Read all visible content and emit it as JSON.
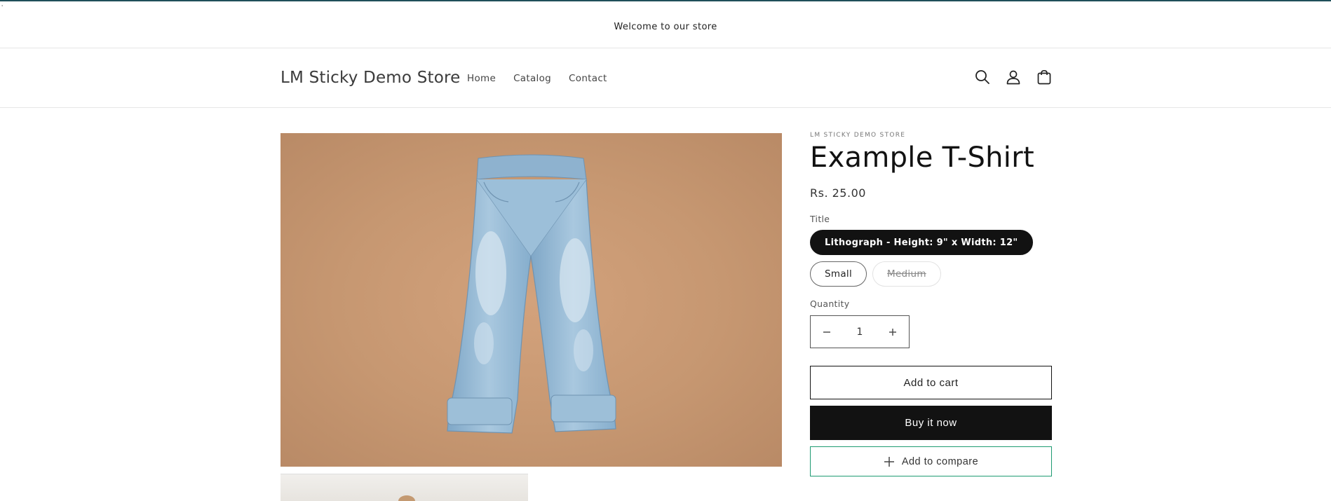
{
  "announcement": {
    "text": "Welcome to our store"
  },
  "header": {
    "logo": "LM Sticky Demo Store",
    "nav": [
      {
        "label": "Home"
      },
      {
        "label": "Catalog"
      },
      {
        "label": "Contact"
      }
    ],
    "icons": [
      "search-icon",
      "account-icon",
      "cart-icon"
    ]
  },
  "product": {
    "vendor": "LM STICKY DEMO STORE",
    "title": "Example T-Shirt",
    "price": "Rs. 25.00",
    "option_label": "Title",
    "options": [
      {
        "label": "Lithograph - Height: 9\" x Width: 12\"",
        "state": "selected"
      },
      {
        "label": "Small",
        "state": "available"
      },
      {
        "label": "Medium",
        "state": "unavailable"
      }
    ],
    "quantity_label": "Quantity",
    "quantity": "1",
    "add_to_cart": "Add to cart",
    "buy_now": "Buy it now",
    "add_to_compare": "Add to compare"
  },
  "colors": {
    "accent_dark": "#121212",
    "compare_border": "#1e9b72",
    "top_rule": "#1f4f5a"
  }
}
